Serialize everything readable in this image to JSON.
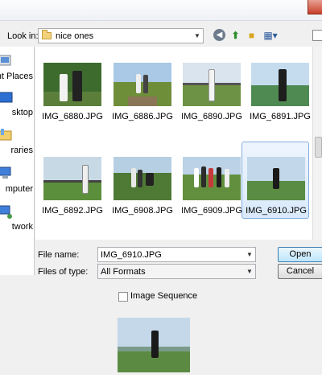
{
  "lookin": {
    "label": "Look in:",
    "value": "nice ones"
  },
  "places": [
    {
      "label": "nt Places",
      "icon": "recent-places-icon"
    },
    {
      "label": "sktop",
      "icon": "desktop-icon"
    },
    {
      "label": "raries",
      "icon": "libraries-icon"
    },
    {
      "label": "mputer",
      "icon": "computer-icon"
    },
    {
      "label": "twork",
      "icon": "network-icon"
    }
  ],
  "files": [
    {
      "name": "IMG_6880.JPG"
    },
    {
      "name": "IMG_6886.JPG"
    },
    {
      "name": "IMG_6890.JPG"
    },
    {
      "name": "IMG_6891.JPG"
    },
    {
      "name": "IMG_6892.JPG"
    },
    {
      "name": "IMG_6908.JPG"
    },
    {
      "name": "IMG_6909.JPG"
    },
    {
      "name": "IMG_6910.JPG",
      "selected": true
    }
  ],
  "form": {
    "filename_label": "File name:",
    "filename_value": "IMG_6910.JPG",
    "filetype_label": "Files of type:",
    "filetype_value": "All Formats",
    "open_label": "Open",
    "cancel_label": "Cancel"
  },
  "options": {
    "image_sequence_label": "Image Sequence",
    "image_sequence_checked": false
  },
  "colors": {
    "selection": "#d9e9fb",
    "selection_border": "#84acdd",
    "default_button": "#bee6fd"
  }
}
